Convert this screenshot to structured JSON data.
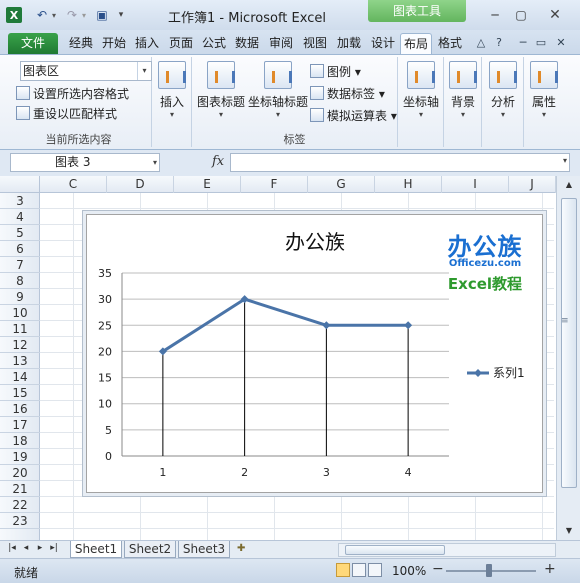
{
  "window": {
    "app_logo": "X",
    "title": "工作簿1 - Microsoft Excel",
    "contextual_tab": "图表工具",
    "undo_glyph": "↶",
    "redo_glyph": "↷",
    "dropdown_glyph": "▾",
    "save_glyph": "▣",
    "qat_more_glyph": "▾",
    "min_glyph": "─",
    "max_glyph": "▢",
    "close_glyph": "✕"
  },
  "ribbon_tabs": [
    "文件",
    "经典",
    "开始",
    "插入",
    "页面",
    "公式",
    "数据",
    "审阅",
    "视图",
    "加载",
    "设计",
    "布局",
    "格式"
  ],
  "ribbon_tab_icons": [
    "△",
    "?",
    "─",
    "▭",
    "✕"
  ],
  "ribbon": {
    "current_selection": {
      "element_select": "图表区",
      "format_selection": "设置所选内容格式",
      "reset_style": "重设以匹配样式",
      "group_label": "当前所选内容"
    },
    "insert": {
      "label": "插入"
    },
    "labels_group": {
      "chart_title": "图表标题",
      "axis_title": "坐标轴标题",
      "legend": "图例",
      "data_labels": "数据标签",
      "data_table": "模拟运算表",
      "group_label": "标签"
    },
    "axes": {
      "label": "坐标轴"
    },
    "background": {
      "label": "背景"
    },
    "analysis": {
      "label": "分析"
    },
    "properties": {
      "label": "属性"
    }
  },
  "formula_bar": {
    "name_box": "图表 3",
    "fx": "fx",
    "formula": ""
  },
  "grid": {
    "columns": [
      "C",
      "D",
      "E",
      "F",
      "G",
      "H",
      "I",
      "J"
    ],
    "rows": [
      "3",
      "4",
      "5",
      "6",
      "7",
      "8",
      "9",
      "10",
      "11",
      "12",
      "13",
      "14",
      "15",
      "16",
      "17",
      "18",
      "19",
      "20",
      "21",
      "22",
      "23"
    ]
  },
  "watermark": {
    "logo": "办公族",
    "site": "Officezu.com",
    "edu": "Excel教程"
  },
  "sheet_tabs": [
    "Sheet1",
    "Sheet2",
    "Sheet3"
  ],
  "sheet_nav": [
    "|◂",
    "◂",
    "▸",
    "▸|"
  ],
  "status": {
    "text": "就绪",
    "zoom": "100%",
    "zoom_minus": "−",
    "zoom_plus": "+"
  },
  "chart_data": {
    "type": "line",
    "title": "办公族",
    "x": [
      1,
      2,
      3,
      4
    ],
    "series": [
      {
        "name": "系列1",
        "values": [
          20,
          30,
          25,
          25
        ]
      }
    ],
    "yticks": [
      0,
      5,
      10,
      15,
      20,
      25,
      30,
      35
    ],
    "ylim": [
      0,
      35
    ],
    "grid": true,
    "drop_lines": true,
    "legend": "right",
    "colors": {
      "series": "#4a74a8",
      "gridline": "#bdbdbd",
      "drop_line": "#000000"
    }
  }
}
